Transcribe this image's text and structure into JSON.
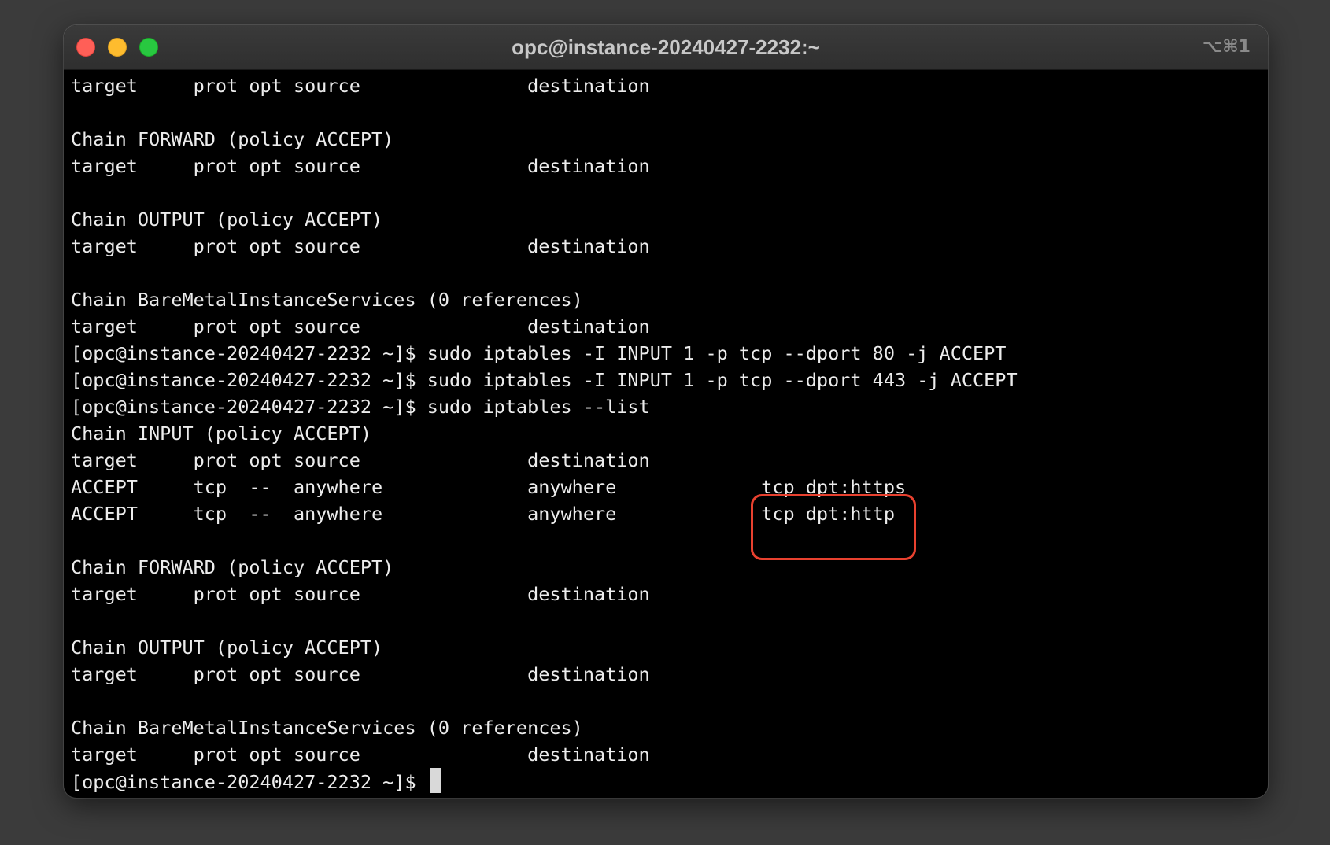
{
  "window": {
    "title": "opc@instance-20240427-2232:~",
    "shortcut": "⌥⌘1"
  },
  "terminal": {
    "lines": [
      "target     prot opt source               destination",
      "",
      "Chain FORWARD (policy ACCEPT)",
      "target     prot opt source               destination",
      "",
      "Chain OUTPUT (policy ACCEPT)",
      "target     prot opt source               destination",
      "",
      "Chain BareMetalInstanceServices (0 references)",
      "target     prot opt source               destination",
      "[opc@instance-20240427-2232 ~]$ sudo iptables -I INPUT 1 -p tcp --dport 80 -j ACCEPT",
      "[opc@instance-20240427-2232 ~]$ sudo iptables -I INPUT 1 -p tcp --dport 443 -j ACCEPT",
      "[opc@instance-20240427-2232 ~]$ sudo iptables --list",
      "Chain INPUT (policy ACCEPT)",
      "target     prot opt source               destination",
      "ACCEPT     tcp  --  anywhere             anywhere             tcp dpt:https",
      "ACCEPT     tcp  --  anywhere             anywhere             tcp dpt:http",
      "",
      "Chain FORWARD (policy ACCEPT)",
      "target     prot opt source               destination",
      "",
      "Chain OUTPUT (policy ACCEPT)",
      "target     prot opt source               destination",
      "",
      "Chain BareMetalInstanceServices (0 references)",
      "target     prot opt source               destination"
    ],
    "prompt": "[opc@instance-20240427-2232 ~]$ "
  },
  "colors": {
    "desktop": "#3b3b3b",
    "terminal_bg": "#000000",
    "terminal_fg": "#ececec",
    "highlight": "#e8412f",
    "close": "#ff5f57",
    "minimize": "#febc2e",
    "zoom": "#28c840"
  }
}
